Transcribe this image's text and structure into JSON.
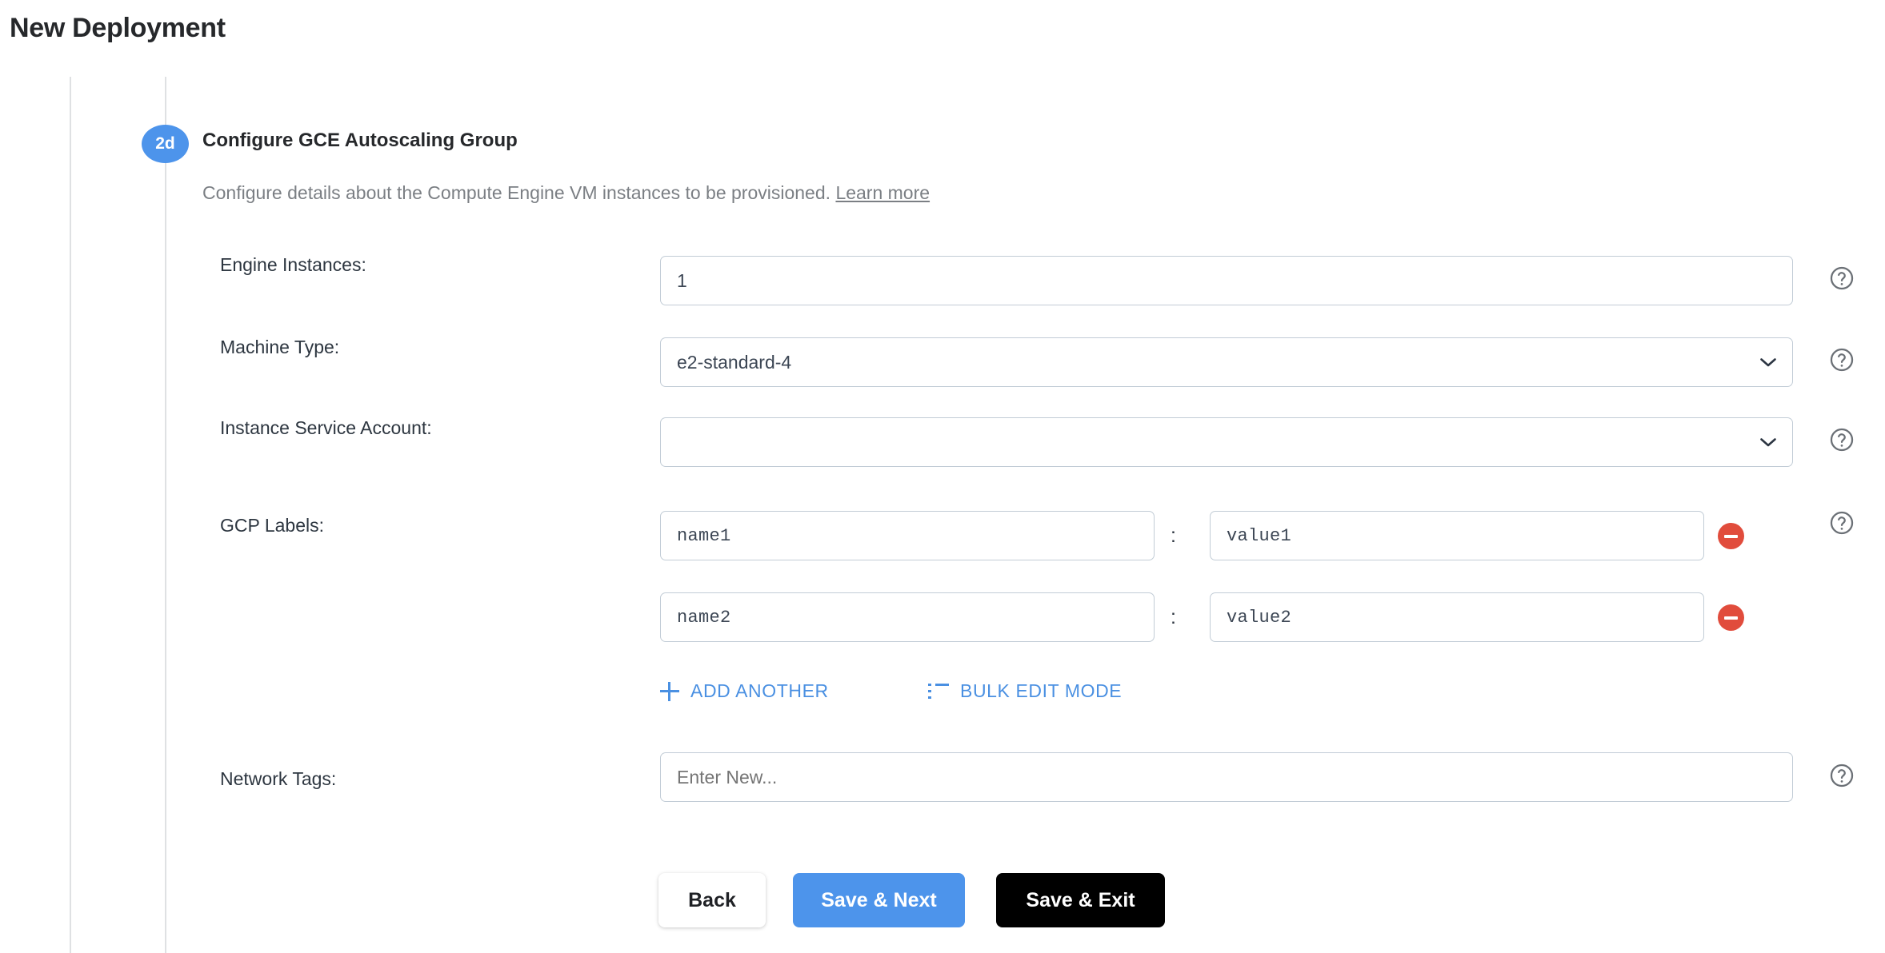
{
  "page": {
    "title": "New Deployment"
  },
  "step": {
    "badge": "2d",
    "heading": "Configure GCE Autoscaling Group",
    "description": "Configure details about the Compute Engine VM instances to be provisioned.",
    "learn_more": "Learn more"
  },
  "form": {
    "engine_instances": {
      "label": "Engine Instances:",
      "value": "1"
    },
    "machine_type": {
      "label": "Machine Type:",
      "value": "e2-standard-4",
      "icon": "chevron-down-icon"
    },
    "instance_service_account": {
      "label": "Instance Service Account:",
      "value": "",
      "icon": "chevron-down-icon"
    },
    "gcp_labels": {
      "label": "GCP Labels:",
      "separator": ":",
      "rows": [
        {
          "key": "name1",
          "value": "value1",
          "remove_icon": "minus-circle-icon"
        },
        {
          "key": "name2",
          "value": "value2",
          "remove_icon": "minus-circle-icon"
        }
      ],
      "add_another": "ADD ANOTHER",
      "add_another_icon": "plus-icon",
      "bulk_edit": "BULK EDIT MODE",
      "bulk_edit_icon": "list-icon"
    },
    "network_tags": {
      "label": "Network Tags:",
      "value": "",
      "placeholder": "Enter New..."
    },
    "help_icon": "help-circle-icon"
  },
  "actions": {
    "back": "Back",
    "save_next": "Save & Next",
    "save_exit": "Save & Exit"
  },
  "colors": {
    "accent_blue": "#4d94eb",
    "link_blue": "#4a90e2",
    "danger_red": "#e14c3c",
    "dark": "#000000",
    "border": "#c2ccd6",
    "rail": "#dfe1e3",
    "muted_text": "#7b7f84"
  }
}
